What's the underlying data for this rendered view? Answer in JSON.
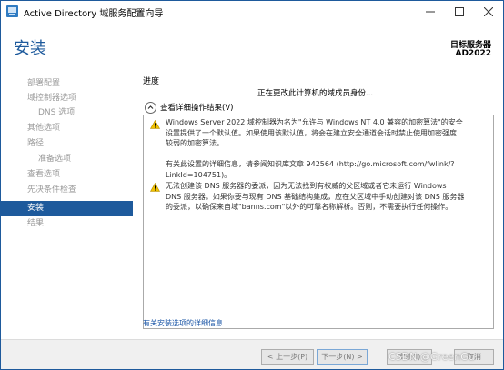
{
  "window": {
    "title": "Active Directory 域服务配置向导",
    "minimize_icon": "minimize-icon",
    "maximize_icon": "maximize-icon",
    "close_icon": "close-icon"
  },
  "header": {
    "page_title": "安装",
    "target_label": "目标服务器",
    "target_server": "AD2022"
  },
  "sidebar": {
    "items": [
      {
        "label": "部署配置",
        "state": "disabled",
        "indent": false
      },
      {
        "label": "域控制器选项",
        "state": "disabled",
        "indent": false
      },
      {
        "label": "DNS 选项",
        "state": "disabled",
        "indent": true
      },
      {
        "label": "其他选项",
        "state": "disabled",
        "indent": false
      },
      {
        "label": "路径",
        "state": "disabled",
        "indent": false
      },
      {
        "label": "准备选项",
        "state": "disabled",
        "indent": true
      },
      {
        "label": "查看选项",
        "state": "disabled",
        "indent": false
      },
      {
        "label": "先决条件检查",
        "state": "disabled",
        "indent": false
      },
      {
        "label": "安装",
        "state": "active",
        "indent": false
      },
      {
        "label": "结果",
        "state": "disabled",
        "indent": false
      }
    ]
  },
  "main": {
    "progress_label": "进度",
    "status_text": "正在更改此计算机的域成员身份...",
    "details_toggle_label": "查看详细操作结果(V)",
    "messages": [
      {
        "icon": "warning-icon",
        "lines": [
          "Windows Server 2022 域控制器为名为\"允许与 Windows NT 4.0 兼容的加密算法\"的安全",
          "设置提供了一个默认值。如果使用该默认值，将会在建立安全通道会话时禁止使用加密强度",
          "较弱的加密算法。",
          "",
          "有关此设置的详细信息，请参阅知识库文章 942564 (http://go.microsoft.com/fwlink/?",
          "LinkId=104751)。"
        ]
      },
      {
        "icon": "warning-icon",
        "lines": [
          "无法创建该 DNS 服务器的委派，因为无法找到有权威的父区域或者它未运行 Windows",
          "DNS 服务器。如果你要与现有 DNS 基础结构集成，应在父区域中手动创建对该 DNS 服务器",
          "的委派，以确保来自域\"banns.com\"以外的可靠名称解析。否则，不需要执行任何操作。"
        ]
      }
    ],
    "more_info_link": "有关安装选项的详细信息"
  },
  "footer": {
    "prev_button": "< 上一步(P)",
    "next_button": "下一步(N) >",
    "install_button": "安装(I)",
    "cancel_button": "取消"
  },
  "watermark": "CSDN @GreenGu",
  "colors": {
    "accent": "#1e5a9c",
    "link": "#1a55a6",
    "warning": "#f2c200"
  }
}
